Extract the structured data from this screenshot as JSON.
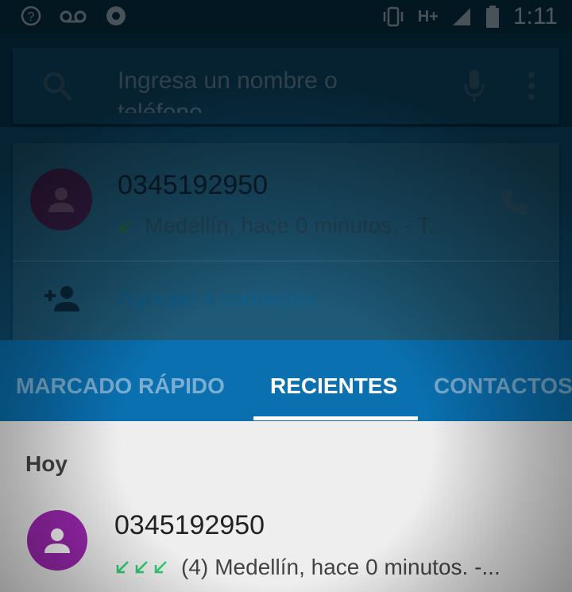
{
  "status_bar": {
    "network_type": "H+",
    "time": "1:11"
  },
  "search": {
    "placeholder": "Ingresa un nombre o teléfono"
  },
  "suggestion_card": {
    "number": "0345192950",
    "detail": "Medellín, hace 0 minutos. - T...",
    "add_contact_label": "Agregar a contactos"
  },
  "tabs": [
    {
      "label": "MARCADO RÁPIDO",
      "selected": false
    },
    {
      "label": "RECIENTES",
      "selected": true
    },
    {
      "label": "CONTACTOS",
      "selected": false
    }
  ],
  "recents": {
    "section_label": "Hoy",
    "items": [
      {
        "number": "0345192950",
        "count": "(4)",
        "detail": "Medellín, hace 0 minutos. -..."
      }
    ]
  },
  "colors": {
    "accent": "#0a70b0",
    "avatar": "#9c27b0",
    "incoming_call": "#2ecc71"
  },
  "icons": [
    "search-icon",
    "mic-icon",
    "more-vert-icon",
    "phone-icon",
    "add-contact-icon",
    "person-icon",
    "incoming-call-icon"
  ]
}
